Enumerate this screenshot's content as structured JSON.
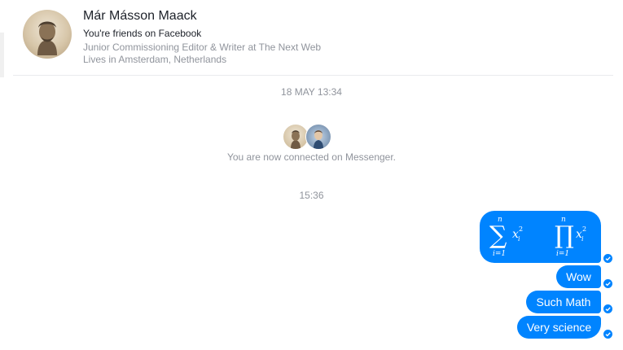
{
  "header": {
    "name": "Már Másson Maack",
    "friends_text": "You're friends on Facebook",
    "job": "Junior Commissioning Editor & Writer at The Next Web",
    "location": "Lives in Amsterdam, Netherlands"
  },
  "conversation": {
    "timestamp_1": "18 MAY 13:34",
    "connected_text": "You are now connected on Messenger.",
    "timestamp_2": "15:36",
    "messages": [
      {
        "type": "math",
        "text": "∑ᵢ₌₁ⁿ xᵢ²   ∏ᵢ₌₁ⁿ xᵢ²",
        "status_icon": "delivered-check-icon"
      },
      {
        "type": "text",
        "text": "Wow",
        "status_icon": "delivered-check-icon"
      },
      {
        "type": "text",
        "text": "Such Math",
        "status_icon": "delivered-check-icon"
      },
      {
        "type": "text",
        "text": "Very science",
        "status_icon": "delivered-check-icon"
      }
    ]
  },
  "colors": {
    "bubble": "#0084ff",
    "meta_text": "#90949c",
    "primary_text": "#1d2129"
  }
}
